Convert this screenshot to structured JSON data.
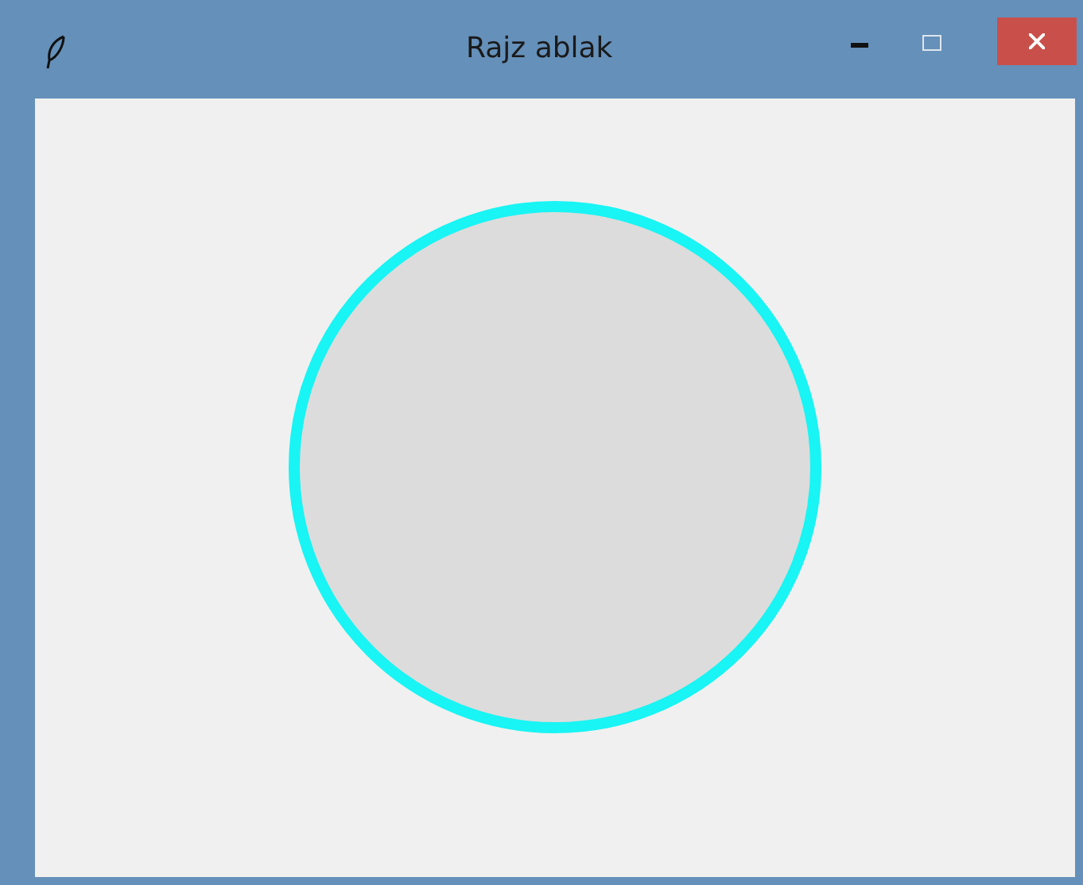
{
  "window": {
    "title": "Rajz ablak"
  },
  "canvas": {
    "shapes": [
      {
        "kind": "circle"
      }
    ]
  }
}
